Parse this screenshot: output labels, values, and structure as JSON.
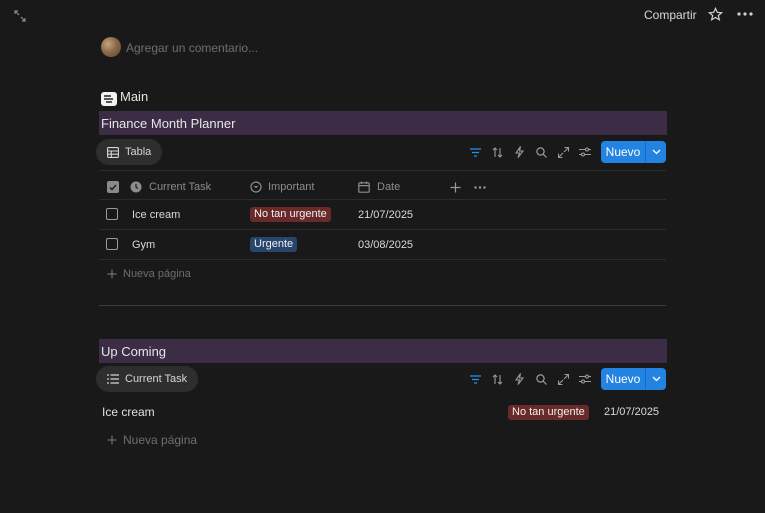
{
  "topbar": {
    "share_label": "Compartir"
  },
  "comment": {
    "placeholder": "Agregar un comentario..."
  },
  "main_heading": {
    "title": "Main"
  },
  "section1": {
    "title": "Finance Month Planner",
    "view_tab": "Tabla",
    "new_button": "Nuevo",
    "columns": [
      "Current Task",
      "Important",
      "Date"
    ],
    "rows": [
      {
        "task": "Ice cream",
        "importance": "No tan urgente",
        "importance_color": "#6b2a2a",
        "date": "21/07/2025"
      },
      {
        "task": "Gym",
        "importance": "Urgente",
        "importance_color": "#28456c",
        "date": "03/08/2025"
      }
    ],
    "new_page": "Nueva página"
  },
  "section2": {
    "title": "Up Coming",
    "view_tab": "Current Task",
    "new_button": "Nuevo",
    "items": [
      {
        "task": "Ice cream",
        "importance": "No tan urgente",
        "importance_color": "#6b2a2a",
        "date": "21/07/2025"
      }
    ],
    "new_page": "Nueva página"
  },
  "colors": {
    "background": "#191919",
    "section_bar": "#3c2c45",
    "accent": "#2383e2"
  }
}
